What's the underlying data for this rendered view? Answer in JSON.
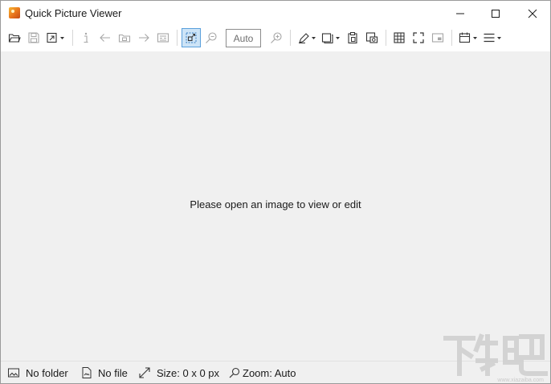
{
  "window": {
    "title": "Quick Picture Viewer",
    "controls": [
      "minimize",
      "maximize",
      "close"
    ]
  },
  "toolbar": {
    "zoom_value": "Auto",
    "buttons": [
      {
        "name": "open-folder-icon"
      },
      {
        "name": "save-icon"
      },
      {
        "name": "open-with-icon",
        "dropdown": true
      },
      {
        "name": "info-icon"
      },
      {
        "name": "previous-icon"
      },
      {
        "name": "slideshow-icon"
      },
      {
        "name": "next-icon"
      },
      {
        "name": "compare-icon"
      },
      {
        "name": "auto-size-icon",
        "active": true
      },
      {
        "name": "zoom-out-icon"
      },
      {
        "name": "zoom-in-icon"
      },
      {
        "name": "draw-icon",
        "dropdown": true
      },
      {
        "name": "copy-icon",
        "dropdown": true
      },
      {
        "name": "paste-icon"
      },
      {
        "name": "screenshot-icon"
      },
      {
        "name": "grid-icon"
      },
      {
        "name": "fullscreen-icon"
      },
      {
        "name": "picture-in-picture-icon"
      },
      {
        "name": "calendar-icon",
        "dropdown": true
      },
      {
        "name": "menu-icon",
        "dropdown": true
      }
    ]
  },
  "viewer": {
    "placeholder": "Please open an image to view or edit",
    "background": "#f0f0f0"
  },
  "statusbar": {
    "folder": "No folder",
    "file": "No file",
    "size": "Size: 0 x 0 px",
    "zoom": "Zoom: Auto"
  },
  "watermark": {
    "text": "下载吧",
    "url": "www.xiazaiba.com"
  },
  "colors": {
    "accent": "#5aa0dc",
    "accent_fill": "#cde4f7",
    "icon": "#333333",
    "icon_disabled": "#a6a6a6"
  }
}
